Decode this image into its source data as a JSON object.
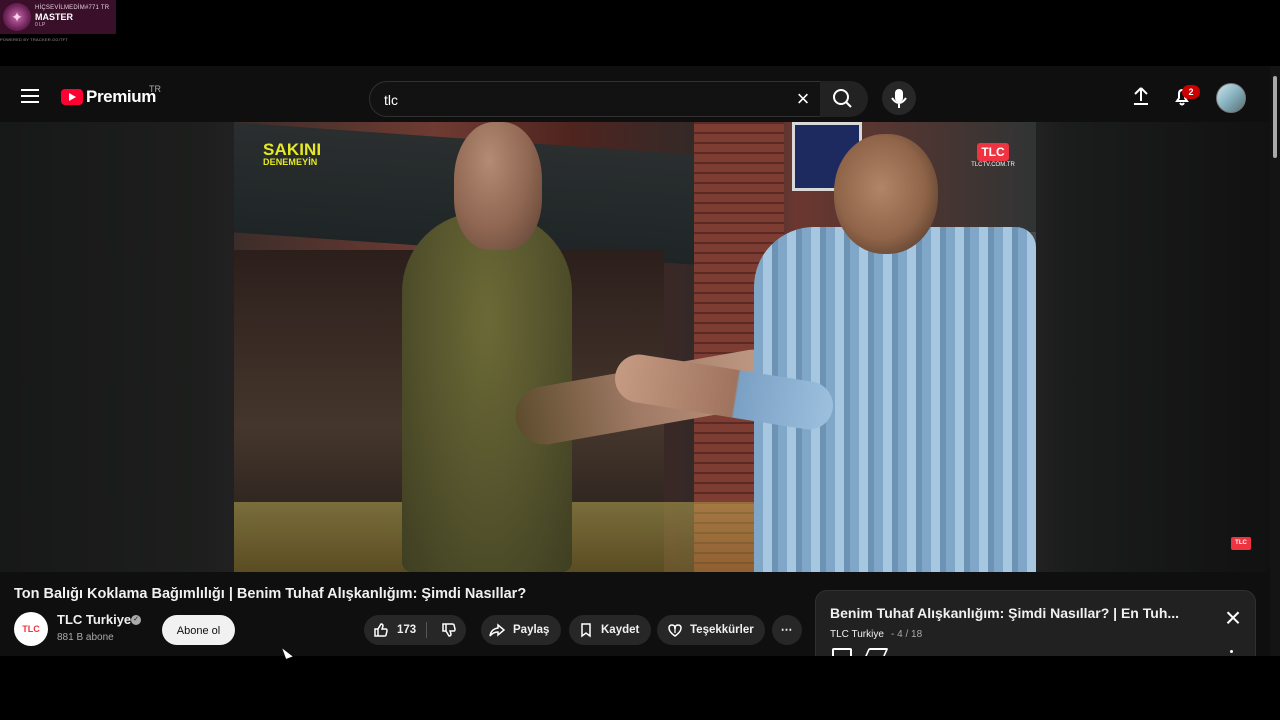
{
  "rank_overlay": {
    "player_name": "HİÇSEVİLMEDİM#771 TR",
    "tier": "MASTER",
    "lp": "0 LP",
    "powered_by": "POWERED BY TRACKER.GG/TFT"
  },
  "youtube": {
    "logo_text": "Premium",
    "country_code": "TR",
    "search_query": "tlc",
    "notification_count": "2",
    "video": {
      "show_logo": "SAKINI",
      "show_logo_sub": "DENEMEYİN",
      "channel_bug": "TLC",
      "channel_bug_url": "TLCTV.COM.TR",
      "corner_watermark": "TLC",
      "title": "Ton Balığı Koklama Bağımlılığı | Benim Tuhaf Alışkanlığım: Şimdi Nasıllar?",
      "channel_name": "TLC Turkiye",
      "channel_avatar": "TLC",
      "subscribers": "881 B abone",
      "subscribe_label": "Abone ol",
      "likes": "173",
      "share_label": "Paylaş",
      "save_label": "Kaydet",
      "thanks_label": "Teşekkürler",
      "more_label": "⋯"
    },
    "playlist": {
      "title": "Benim Tuhaf Alışkanlığım: Şimdi Nasıllar? | En Tuh...",
      "channel": "TLC Turkiye",
      "position": "- 4 / 18"
    }
  }
}
